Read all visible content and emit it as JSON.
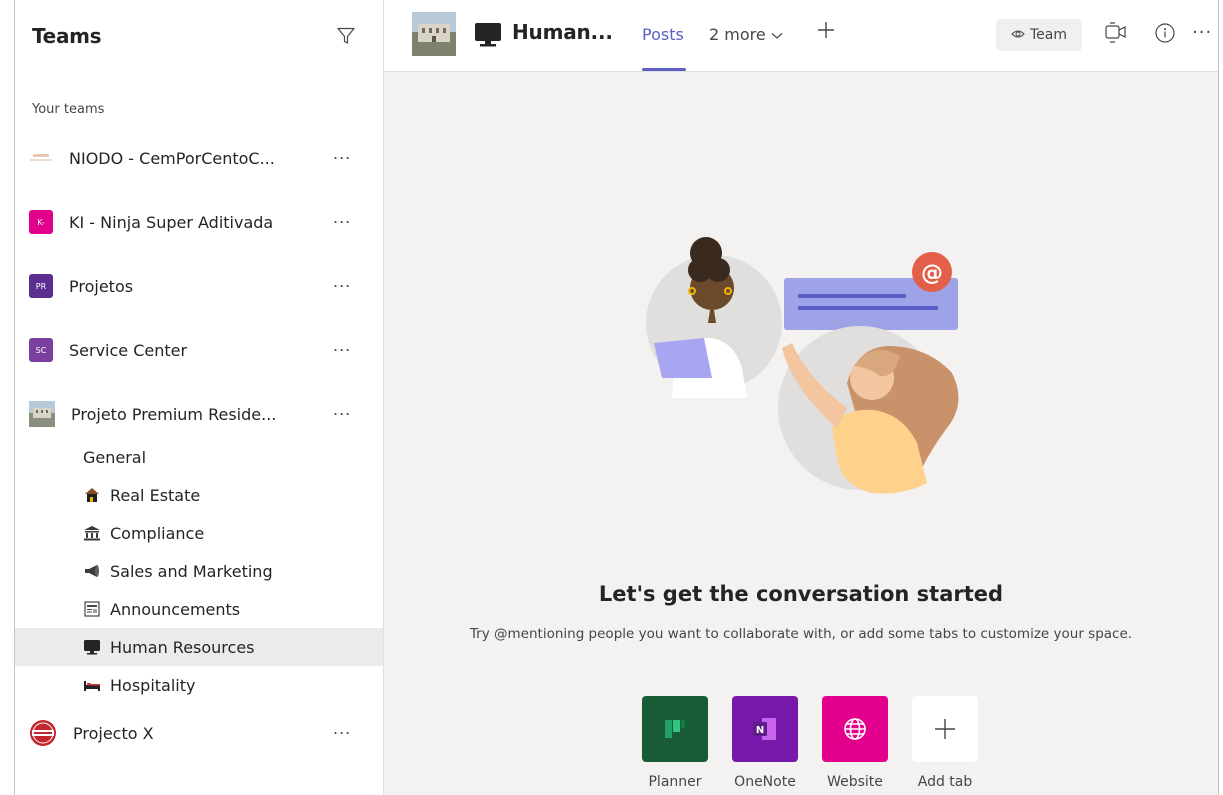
{
  "sidebar": {
    "title": "Teams",
    "section_label": "Your teams",
    "teams": [
      {
        "name": "NIODO - CemPorCentoC...",
        "avatar_text": "",
        "color": "#f3e9e2"
      },
      {
        "name": "KI - Ninja Super Aditivada",
        "avatar_text": "K-",
        "color": "#e3008c"
      },
      {
        "name": "Projetos",
        "avatar_text": "PR",
        "color": "#5c2e91"
      },
      {
        "name": "Service Center",
        "avatar_text": "SC",
        "color": "#7b3f9e"
      },
      {
        "name": "Projeto Premium Reside...",
        "avatar_text": "",
        "color": "#8fa3b3"
      },
      {
        "name": "Projecto X",
        "avatar_text": "",
        "color": "#c4262e"
      }
    ],
    "more_label": "···",
    "channels": [
      {
        "name": "General",
        "icon": ""
      },
      {
        "name": "Real Estate",
        "icon": "house-icon"
      },
      {
        "name": "Compliance",
        "icon": "bank-icon"
      },
      {
        "name": "Sales and Marketing",
        "icon": "megaphone-icon"
      },
      {
        "name": "Announcements",
        "icon": "newspaper-icon"
      },
      {
        "name": "Human Resources",
        "icon": "monitor-icon"
      },
      {
        "name": "Hospitality",
        "icon": "bed-icon"
      }
    ],
    "active_channel": "Human Resources"
  },
  "header": {
    "channel_title": "Human...",
    "tabs": {
      "posts": "Posts",
      "more": "2 more"
    },
    "team_button": "Team",
    "ellipsis": "···",
    "accent": "#5b5fc7"
  },
  "empty_state": {
    "title": "Let's get the conversation started",
    "subtitle": "Try @mentioning people you want to collaborate with, or add some tabs to customize your space."
  },
  "apps": [
    {
      "label": "Planner",
      "color": "#185c37",
      "icon": "planner-icon"
    },
    {
      "label": "OneNote",
      "color": "#7719aa",
      "icon": "onenote-icon"
    },
    {
      "label": "Website",
      "color": "#e3008c",
      "icon": "globe-icon"
    },
    {
      "label": "Add tab",
      "color": "#ffffff",
      "icon": "plus-icon"
    }
  ]
}
